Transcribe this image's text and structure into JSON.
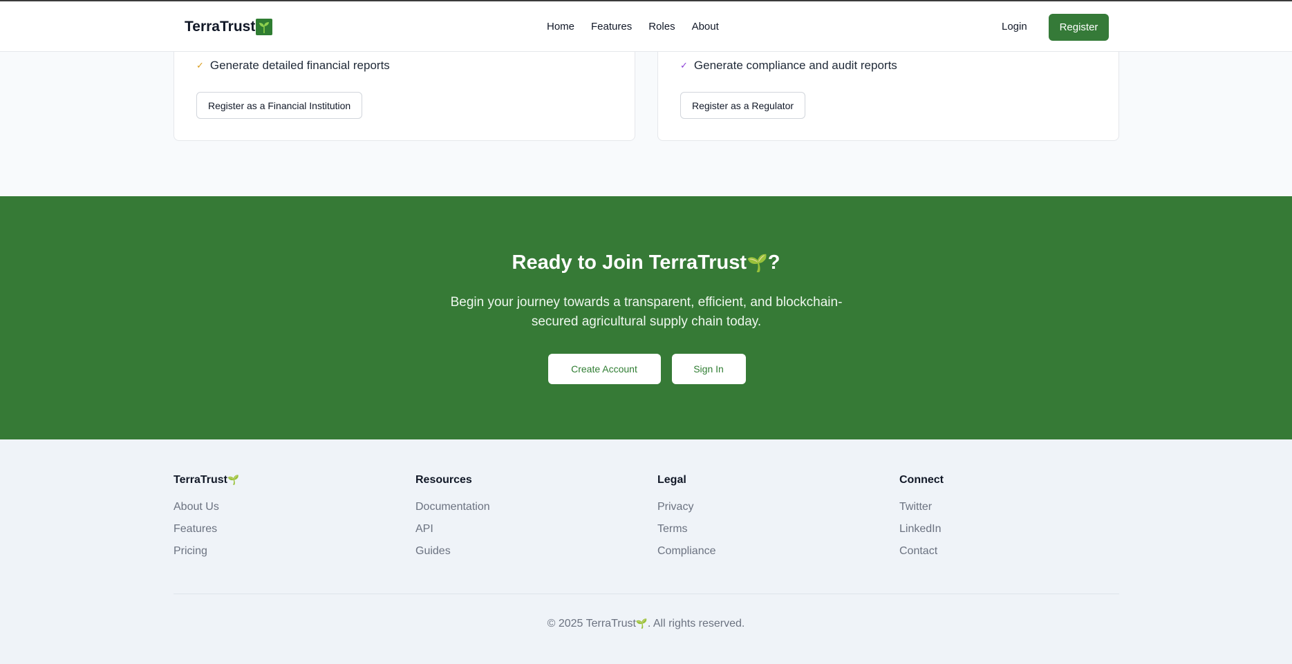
{
  "header": {
    "brand": "TerraTrust",
    "brand_icon": "sprout-icon",
    "nav": [
      "Home",
      "Features",
      "Roles",
      "About"
    ],
    "login": "Login",
    "register": "Register"
  },
  "cards": {
    "financial": {
      "feature": "Generate detailed financial reports",
      "button": "Register as a Financial Institution",
      "check_color": "#d99c1c"
    },
    "regulator": {
      "feature": "Generate compliance and audit reports",
      "button": "Register as a Regulator",
      "check_color": "#8b3fd6"
    }
  },
  "cta": {
    "title": "Ready to Join TerraTrust",
    "title_suffix": "?",
    "description": "Begin your journey towards a transparent, efficient, and blockchain-secured agricultural supply chain today.",
    "create_account": "Create Account",
    "sign_in": "Sign In",
    "background": "#367a36"
  },
  "footer": {
    "columns": [
      {
        "heading": "TerraTrust",
        "links": [
          "About Us",
          "Features",
          "Pricing"
        ]
      },
      {
        "heading": "Resources",
        "links": [
          "Documentation",
          "API",
          "Guides"
        ]
      },
      {
        "heading": "Legal",
        "links": [
          "Privacy",
          "Terms",
          "Compliance"
        ]
      },
      {
        "heading": "Connect",
        "links": [
          "Twitter",
          "LinkedIn",
          "Contact"
        ]
      }
    ],
    "copyright_prefix": "© 2025 TerraTrust",
    "copyright_suffix": ". All rights reserved."
  },
  "icons": {
    "check": "check-icon",
    "sprout": "sprout-icon"
  }
}
